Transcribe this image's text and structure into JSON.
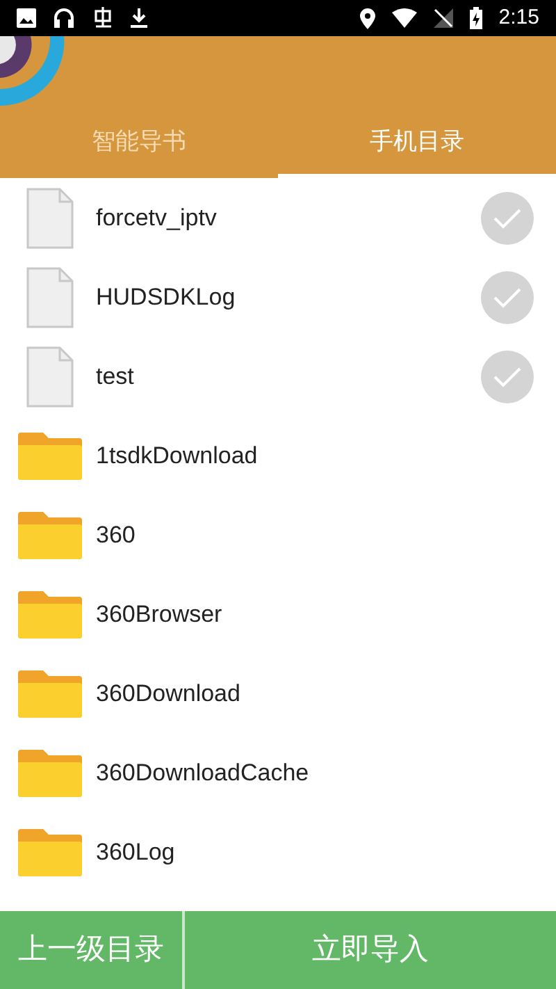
{
  "status_bar": {
    "time": "2:15"
  },
  "tabs": [
    {
      "label": "智能导书",
      "selected": false
    },
    {
      "label": "手机目录",
      "selected": true
    }
  ],
  "files": [
    {
      "kind": "file",
      "name": "forcetv_iptv",
      "checked": false
    },
    {
      "kind": "file",
      "name": "HUDSDKLog",
      "checked": false
    },
    {
      "kind": "file",
      "name": "test",
      "checked": false
    },
    {
      "kind": "folder",
      "name": "1tsdkDownload"
    },
    {
      "kind": "folder",
      "name": "360"
    },
    {
      "kind": "folder",
      "name": "360Browser"
    },
    {
      "kind": "folder",
      "name": "360Download"
    },
    {
      "kind": "folder",
      "name": "360DownloadCache"
    },
    {
      "kind": "folder",
      "name": "360Log"
    }
  ],
  "buttons": {
    "parent": "上一级目录",
    "import": "立即导入"
  }
}
